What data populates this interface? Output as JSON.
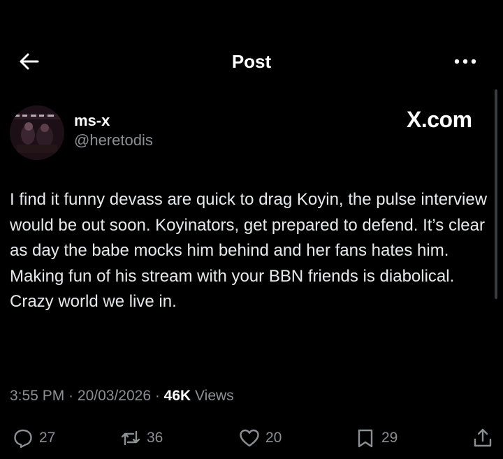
{
  "header": {
    "title": "Post",
    "back_icon": "arrow-left-icon",
    "more_icon": "more-horizontal-icon"
  },
  "author": {
    "name": "ms-x",
    "handle": "@heretodis"
  },
  "brand": {
    "label": "X.com"
  },
  "post": {
    "text": "I find it funny devass are quick to drag Koyin, the pulse interview would be out soon. Koyinators, get prepared to defend. It’s clear as day the babe mocks him behind and her fans hates him. Making fun of his stream with your BBN friends is diabolical. Crazy world we live in.",
    "time": "3:55 PM",
    "date": "20/03/2026",
    "views_count": "46K",
    "views_label": "Views"
  },
  "actions": {
    "replies": "27",
    "reposts": "36",
    "likes": "20",
    "bookmarks": "29"
  },
  "colors": {
    "background": "#000000",
    "text": "#e7e9ea",
    "muted": "#8b9095"
  }
}
